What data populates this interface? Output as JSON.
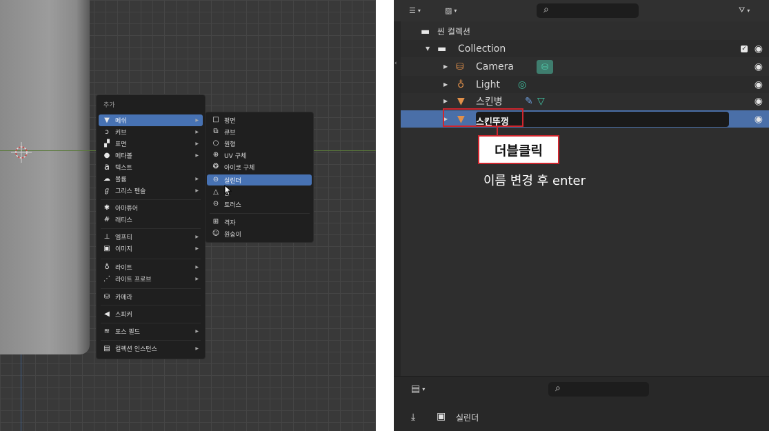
{
  "add_menu": {
    "title": "추가",
    "items": [
      {
        "label": "메쉬",
        "icon": "mesh-icon",
        "submenu": true,
        "active": true
      },
      {
        "label": "커브",
        "icon": "curve-icon",
        "submenu": true
      },
      {
        "label": "표면",
        "icon": "surface-icon",
        "submenu": true
      },
      {
        "label": "메타볼",
        "icon": "metaball-icon",
        "submenu": true
      },
      {
        "label": "텍스트",
        "icon": "text-icon",
        "submenu": false
      },
      {
        "label": "볼륨",
        "icon": "volume-icon",
        "submenu": true
      },
      {
        "label": "그리스 펜슬",
        "icon": "grease-pencil-icon",
        "submenu": true
      },
      {
        "label": "아마튜어",
        "icon": "armature-icon",
        "submenu": false
      },
      {
        "label": "래티스",
        "icon": "lattice-icon",
        "submenu": false
      },
      {
        "label": "엠프티",
        "icon": "empty-icon",
        "submenu": true
      },
      {
        "label": "이미지",
        "icon": "image-icon",
        "submenu": true
      },
      {
        "label": "라이트",
        "icon": "light-icon",
        "submenu": true
      },
      {
        "label": "라이트 프로브",
        "icon": "light-probe-icon",
        "submenu": true
      },
      {
        "label": "카메라",
        "icon": "camera-icon",
        "submenu": false
      },
      {
        "label": "스피커",
        "icon": "speaker-icon",
        "submenu": false
      },
      {
        "label": "포스 필드",
        "icon": "force-field-icon",
        "submenu": true
      },
      {
        "label": "컬렉션 인스턴스",
        "icon": "collection-instance-icon",
        "submenu": true
      }
    ]
  },
  "mesh_submenu": {
    "items": [
      {
        "label": "평면",
        "icon": "plane-icon"
      },
      {
        "label": "큐브",
        "icon": "cube-icon"
      },
      {
        "label": "원형",
        "icon": "circle-icon"
      },
      {
        "label": "UV 구체",
        "icon": "uv-sphere-icon"
      },
      {
        "label": "아이코 구체",
        "icon": "ico-sphere-icon"
      },
      {
        "label": "실린더",
        "icon": "cylinder-icon",
        "active": true
      },
      {
        "label": "콘",
        "icon": "cone-icon"
      },
      {
        "label": "토러스",
        "icon": "torus-icon"
      },
      {
        "label": "격자",
        "icon": "grid-icon"
      },
      {
        "label": "원숭이",
        "icon": "monkey-icon"
      }
    ]
  },
  "outliner": {
    "scene_collection": "씬 컬렉션",
    "collection": "Collection",
    "objects": [
      {
        "name": "Camera",
        "icon": "camera-object-icon"
      },
      {
        "name": "Light",
        "icon": "light-object-icon"
      },
      {
        "name": "스킨병",
        "icon": "mesh-object-icon"
      }
    ],
    "rename_value": "스킨뚜껑"
  },
  "annotation": {
    "callout": "더블클릭",
    "instruction": "이름 변경 후 enter"
  },
  "properties": {
    "object_name": "실린더"
  },
  "colors": {
    "selection": "#4772b3",
    "outline_red": "#d0262e"
  }
}
